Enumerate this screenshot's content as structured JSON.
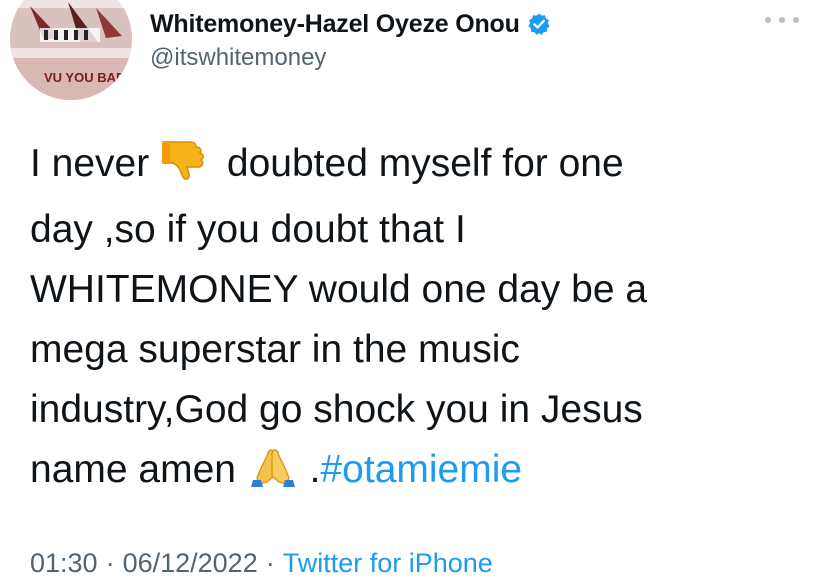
{
  "author": {
    "display_name": "Whitemoney-Hazel Oyeze Onou",
    "handle": "@itswhitemoney",
    "verified": true,
    "avatar_text": "VU YOU BAD"
  },
  "tweet": {
    "lines": [
      {
        "before": "I never",
        "emoji": "thumbs-down-icon",
        "after": "doubted myself for one"
      },
      {
        "text": "day ,so if you doubt that I"
      },
      {
        "text": "WHITEMONEY would one day be a"
      },
      {
        "text": "mega superstar in the music"
      },
      {
        "text": "industry,God go shock you in Jesus"
      },
      {
        "before": "name amen",
        "emoji": "praying-hands-icon",
        "after": ".",
        "hashtag": "#otamiemie"
      }
    ]
  },
  "meta": {
    "time": "01:30",
    "date": "06/12/2022",
    "separator": "·",
    "source": "Twitter for iPhone"
  },
  "colors": {
    "text": "#0f1419",
    "secondary": "#536471",
    "link": "#1d9bf0"
  }
}
